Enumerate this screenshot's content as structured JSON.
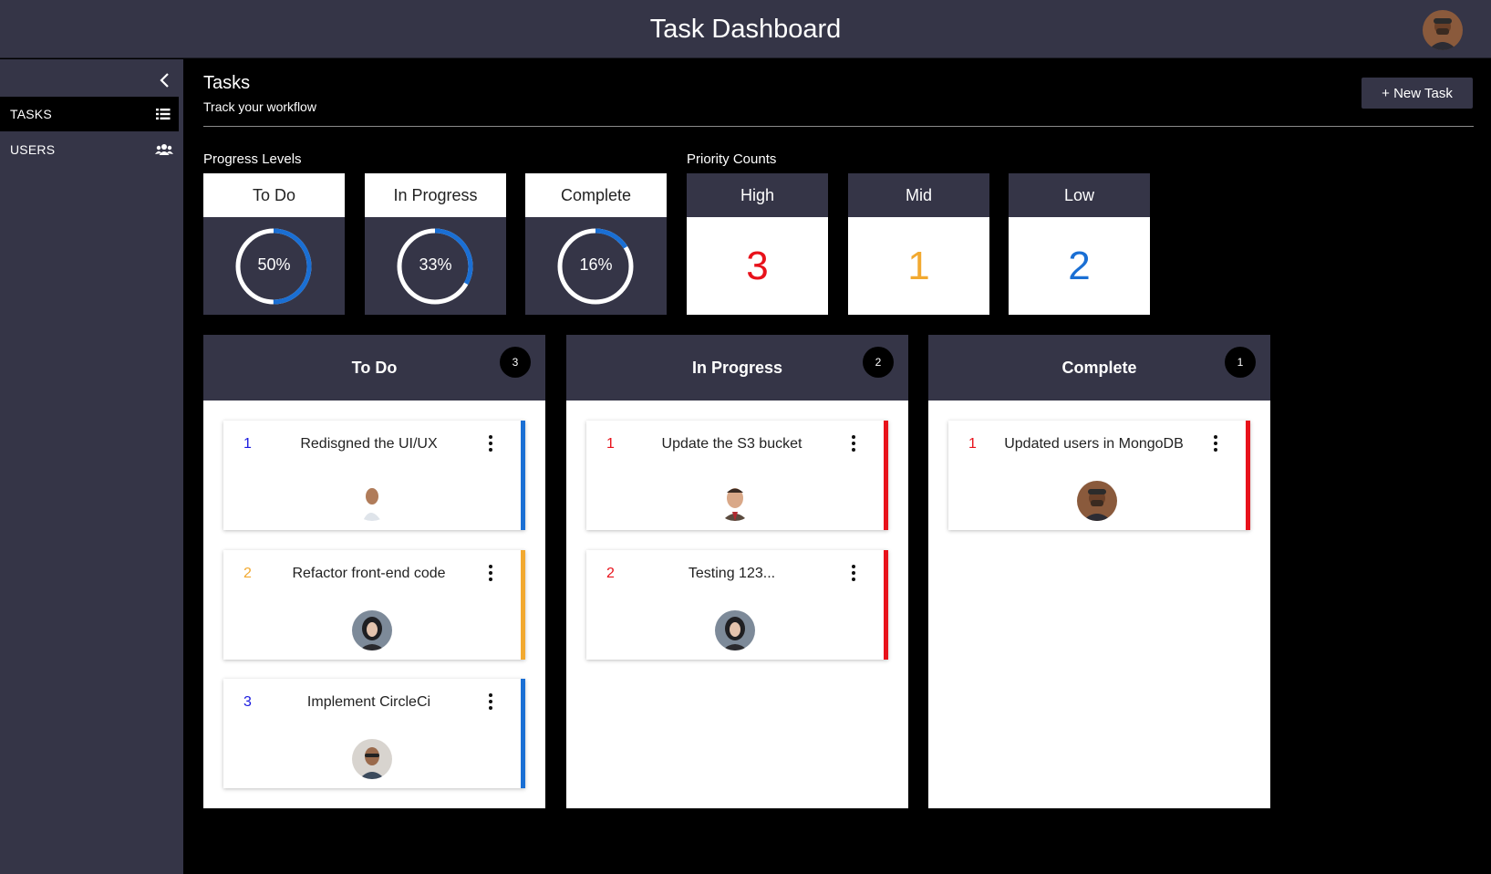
{
  "header": {
    "title": "Task Dashboard",
    "avatar_icon": "user-avatar"
  },
  "sidebar": {
    "collapse_icon": "chevron-left-icon",
    "items": [
      {
        "label": "TASKS",
        "icon": "list-icon",
        "active": true
      },
      {
        "label": "USERS",
        "icon": "users-icon",
        "active": false
      }
    ]
  },
  "page": {
    "title": "Tasks",
    "subtitle": "Track your workflow",
    "new_task_label": "+ New Task"
  },
  "progress": {
    "label": "Progress Levels",
    "items": [
      {
        "name": "To Do",
        "percent": 50,
        "label": "50%"
      },
      {
        "name": "In Progress",
        "percent": 33,
        "label": "33%"
      },
      {
        "name": "Complete",
        "percent": 16,
        "label": "16%"
      }
    ]
  },
  "priority": {
    "label": "Priority Counts",
    "items": [
      {
        "name": "High",
        "count": "3",
        "color": "#e8121b"
      },
      {
        "name": "Mid",
        "count": "1",
        "color": "#f2a930"
      },
      {
        "name": "Low",
        "count": "2",
        "color": "#1a6fd4"
      }
    ]
  },
  "colors": {
    "panel": "#353547",
    "ring_track": "#ffffff",
    "ring_fill": "#1a6fd4",
    "priority_high": "#e8121b",
    "priority_mid": "#f2a930",
    "priority_low": "#1a6fd4"
  },
  "columns": [
    {
      "title": "To Do",
      "count": "3",
      "tasks": [
        {
          "num": "1",
          "num_color": "#1a1adf",
          "name": "Redisgned the UI/UX",
          "bar_color": "#1a6fd4",
          "avatar": "bald-man-avatar"
        },
        {
          "num": "2",
          "num_color": "#f2a930",
          "name": "Refactor front-end code",
          "bar_color": "#f2a930",
          "avatar": "woman-avatar"
        },
        {
          "num": "3",
          "num_color": "#1a1adf",
          "name": "Implement CircleCi",
          "bar_color": "#1a6fd4",
          "avatar": "man-glasses-avatar"
        }
      ]
    },
    {
      "title": "In Progress",
      "count": "2",
      "tasks": [
        {
          "num": "1",
          "num_color": "#e8121b",
          "name": "Update the S3 bucket",
          "bar_color": "#e8121b",
          "avatar": "mr-bean-avatar"
        },
        {
          "num": "2",
          "num_color": "#e8121b",
          "name": "Testing 123...",
          "bar_color": "#e8121b",
          "avatar": "woman-avatar"
        }
      ]
    },
    {
      "title": "Complete",
      "count": "1",
      "tasks": [
        {
          "num": "1",
          "num_color": "#e8121b",
          "name": "Updated users in MongoDB",
          "bar_color": "#e8121b",
          "avatar": "man-cap-avatar"
        }
      ]
    }
  ]
}
